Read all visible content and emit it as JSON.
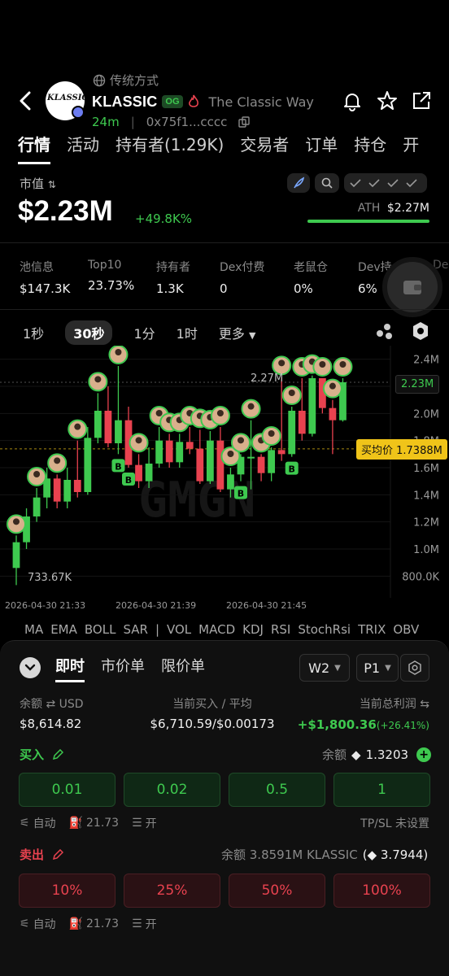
{
  "header": {
    "subtitle": "传统方式",
    "token_name": "KLASSIC",
    "badge": "OG",
    "tagline": "The Classic Way",
    "age": "24m",
    "address": "0x75f1...cccc",
    "avatar_text": "KLASSIC"
  },
  "tabs": [
    "行情",
    "活动",
    "持有者(1.29K)",
    "交易者",
    "订单",
    "持仓",
    "开"
  ],
  "market": {
    "cap_label": "市值",
    "cap_value": "$2.23M",
    "change": "+49.8K%",
    "ath_label": "ATH",
    "ath_value": "$2.27M"
  },
  "stats": [
    {
      "label": "池信息",
      "value": "$147.3K"
    },
    {
      "label": "Top10",
      "value": "23.73%"
    },
    {
      "label": "持有者",
      "value": "1.3K"
    },
    {
      "label": "Dex付费",
      "value": "0"
    },
    {
      "label": "老鼠仓",
      "value": "0%"
    },
    {
      "label": "Dev持仓",
      "value": "6%"
    },
    {
      "label": "De",
      "value": ""
    }
  ],
  "intervals": [
    "1秒",
    "30秒",
    "1分",
    "1时",
    "更多"
  ],
  "chart_data": {
    "type": "candlestick",
    "y_ticks": [
      "2.4M",
      "2.2M",
      "2.0M",
      "1.8M",
      "1.6M",
      "1.4M",
      "1.2M",
      "1.0M",
      "800.0K"
    ],
    "x_ticks": [
      "2026-04-30 21:33",
      "2026-04-30 21:39",
      "2026-04-30 21:45"
    ],
    "current_price": "2.23M",
    "avg_price_label": "买均价 1.7388M",
    "low_label": "733.67K",
    "high_label": "2.27M",
    "ylim": [
      700000,
      2500000
    ],
    "candles": [
      {
        "o": 860000,
        "c": 1050000,
        "h": 1100000,
        "l": 733670
      },
      {
        "o": 1050000,
        "c": 1240000,
        "h": 1300000,
        "l": 1000000
      },
      {
        "o": 1240000,
        "c": 1380000,
        "h": 1450000,
        "l": 1200000
      },
      {
        "o": 1380000,
        "c": 1520000,
        "h": 1600000,
        "l": 1300000
      },
      {
        "o": 1520000,
        "c": 1350000,
        "h": 1550000,
        "l": 1300000
      },
      {
        "o": 1350000,
        "c": 1510000,
        "h": 1600000,
        "l": 1300000
      },
      {
        "o": 1510000,
        "c": 1420000,
        "h": 1800000,
        "l": 1380000
      },
      {
        "o": 1420000,
        "c": 1820000,
        "h": 1900000,
        "l": 1400000
      },
      {
        "o": 1820000,
        "c": 2020000,
        "h": 2150000,
        "l": 1780000
      },
      {
        "o": 2020000,
        "c": 1780000,
        "h": 2200000,
        "l": 1750000
      },
      {
        "o": 1780000,
        "c": 1950000,
        "h": 2350000,
        "l": 1700000
      },
      {
        "o": 1950000,
        "c": 1620000,
        "h": 2050000,
        "l": 1600000
      },
      {
        "o": 1620000,
        "c": 1500000,
        "h": 1700000,
        "l": 1450000
      },
      {
        "o": 1500000,
        "c": 1630000,
        "h": 1750000,
        "l": 1450000
      },
      {
        "o": 1630000,
        "c": 1800000,
        "h": 1900000,
        "l": 1600000
      },
      {
        "o": 1800000,
        "c": 1640000,
        "h": 1850000,
        "l": 1600000
      },
      {
        "o": 1640000,
        "c": 1790000,
        "h": 1850000,
        "l": 1600000
      },
      {
        "o": 1790000,
        "c": 1740000,
        "h": 1900000,
        "l": 1700000
      },
      {
        "o": 1740000,
        "c": 1500000,
        "h": 1880000,
        "l": 1480000
      },
      {
        "o": 1500000,
        "c": 1800000,
        "h": 1870000,
        "l": 1480000
      },
      {
        "o": 1800000,
        "c": 1440000,
        "h": 1900000,
        "l": 1420000
      },
      {
        "o": 1440000,
        "c": 1550000,
        "h": 1600000,
        "l": 1380000
      },
      {
        "o": 1550000,
        "c": 1680000,
        "h": 1700000,
        "l": 1500000
      },
      {
        "o": 1680000,
        "c": 1680000,
        "h": 1950000,
        "l": 1440000
      },
      {
        "o": 1680000,
        "c": 1560000,
        "h": 1700000,
        "l": 1500000
      },
      {
        "o": 1560000,
        "c": 1730000,
        "h": 1750000,
        "l": 1500000
      },
      {
        "o": 1730000,
        "c": 1700000,
        "h": 2270000,
        "l": 1650000
      },
      {
        "o": 1700000,
        "c": 2020000,
        "h": 2050000,
        "l": 1680000
      },
      {
        "o": 2020000,
        "c": 1850000,
        "h": 2260000,
        "l": 1800000
      },
      {
        "o": 1850000,
        "c": 2260000,
        "h": 2280000,
        "l": 1830000
      },
      {
        "o": 2260000,
        "c": 2040000,
        "h": 2260000,
        "l": 2000000
      },
      {
        "o": 2040000,
        "c": 1950000,
        "h": 2100000,
        "l": 1700000
      },
      {
        "o": 1950000,
        "c": 2230000,
        "h": 2260000,
        "l": 1940000
      }
    ],
    "buy_markers": [
      10,
      11,
      22,
      27
    ]
  },
  "indicators": [
    "MA",
    "EMA",
    "BOLL",
    "SAR",
    "|",
    "VOL",
    "MACD",
    "KDJ",
    "RSI",
    "StochRsi",
    "TRIX",
    "OBV"
  ],
  "trade": {
    "order_tabs": [
      "即时",
      "市价单",
      "限价单"
    ],
    "wallet_select": "W2",
    "preset_select": "P1",
    "balance_label": "余额",
    "balance_unit": "USD",
    "balance_value": "$8,614.82",
    "current_buy_label": "当前买入 / 平均",
    "current_buy_value": "$6,710.59/$0.00173",
    "pnl_label": "当前总利润",
    "pnl_value": "+$1,800.36",
    "pnl_pct": "(+26.41%)",
    "buy_label": "买入",
    "buy_balance_label": "余额",
    "buy_balance_value": "1.3203",
    "buy_amounts": [
      "0.01",
      "0.02",
      "0.5",
      "1"
    ],
    "buy_opts": {
      "auto": "自动",
      "gas": "21.73",
      "mev": "开",
      "tpsl": "TP/SL 未设置"
    },
    "sell_label": "卖出",
    "sell_balance_text": "余额 3.8591M KLASSIC",
    "sell_balance_eth": "3.7944",
    "sell_pcts": [
      "10%",
      "25%",
      "50%",
      "100%"
    ],
    "sell_opts": {
      "auto": "自动",
      "gas": "21.73",
      "mev": "开"
    }
  },
  "colors": {
    "up": "#3ec94f",
    "down": "#e8424f",
    "avg_line": "#f0c419"
  }
}
